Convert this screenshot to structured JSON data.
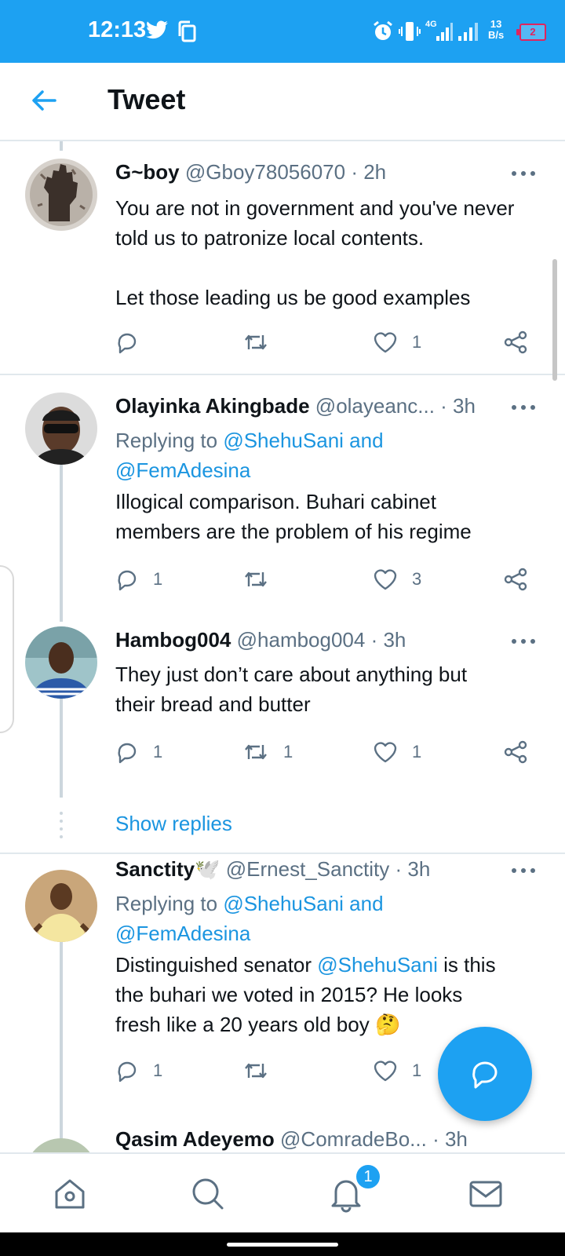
{
  "status_bar": {
    "time": "12:13",
    "net_speed_value": "13",
    "net_speed_unit": "B/s",
    "battery_level": "2"
  },
  "header": {
    "title": "Tweet"
  },
  "tweets": [
    {
      "name": "G~boy",
      "handle": "@Gboy78056070",
      "time": "· 2h",
      "text_line1": "You are not in government and you've never",
      "text_line2": "told us to patronize local contents.",
      "text_line3": "Let those leading us be good examples",
      "reply_count": "",
      "retweet_count": "",
      "like_count": "1"
    },
    {
      "name": "Olayinka Akingbade",
      "handle": "@olayeanc...",
      "time": "· 3h",
      "replying_prefix": "Replying to",
      "replying_users1": "@ShehuSani and",
      "replying_users2": "@FemAdesina",
      "text_line1": "Illogical comparison. Buhari cabinet",
      "text_line2": "members are the problem of his regime",
      "reply_count": "1",
      "retweet_count": "",
      "like_count": "3"
    },
    {
      "name": "Hambog004",
      "handle": "@hambog004",
      "time": "· 3h",
      "text_line1": "They just don’t care about anything but",
      "text_line2": "their bread and butter",
      "reply_count": "1",
      "retweet_count": "1",
      "like_count": "1",
      "show_replies": "Show replies"
    },
    {
      "name": "Sanctity🕊️",
      "handle": "@Ernest_Sanctity",
      "time": "· 3h",
      "replying_prefix": "Replying to",
      "replying_users1": "@ShehuSani and",
      "replying_users2": "@FemAdesina",
      "text_line1_pre": "Distinguished senator ",
      "text_line1_mention": "@ShehuSani",
      "text_line1_post": " is this",
      "text_line2": "the buhari we voted in 2015? He looks",
      "text_line3": "fresh like a 20 years old boy 🤔",
      "reply_count": "1",
      "retweet_count": "",
      "like_count": "1"
    },
    {
      "name": "Qasim Adeyemo",
      "handle": "@ComradeBo...",
      "time": "· 3h"
    }
  ],
  "bottom_nav": {
    "notifications_badge": "1"
  },
  "icons": [
    "back-arrow-icon",
    "reply-icon",
    "retweet-icon",
    "like-icon",
    "share-icon",
    "more-icon",
    "compose-reply-icon",
    "home-icon",
    "search-icon",
    "notifications-icon",
    "messages-icon"
  ],
  "colors": {
    "accent": "#1da1f2",
    "link": "#1b95e0",
    "muted": "#5b7083",
    "divider": "#e1e8ed"
  }
}
